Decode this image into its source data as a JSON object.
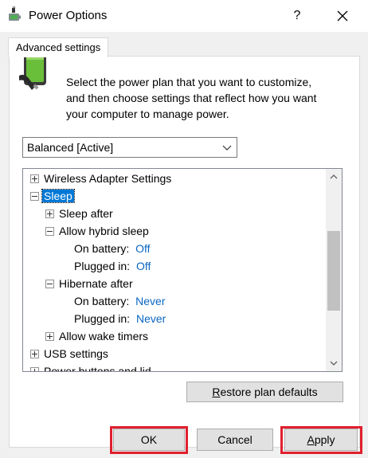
{
  "window": {
    "title": "Power Options",
    "help_label": "?",
    "close_label": "✕",
    "icon": "power-options-icon"
  },
  "tab": {
    "label": "Advanced settings"
  },
  "intro": {
    "line1": "Select the power plan that you want to customize,",
    "line2": "and then choose settings that reflect how you want",
    "line3": "your computer to manage power.",
    "icon": "battery-plug-icon"
  },
  "plan_select": {
    "value": "Balanced [Active]"
  },
  "tree": {
    "wireless": "Wireless Adapter Settings",
    "sleep": "Sleep",
    "sleep_after": "Sleep after",
    "hybrid_sleep": "Allow hybrid sleep",
    "hybrid_battery_label": "On battery:",
    "hybrid_battery_value": "Off",
    "hybrid_plugged_label": "Plugged in:",
    "hybrid_plugged_value": "Off",
    "hibernate_after": "Hibernate after",
    "hibernate_battery_label": "On battery:",
    "hibernate_battery_value": "Never",
    "hibernate_plugged_label": "Plugged in:",
    "hibernate_plugged_value": "Never",
    "wake_timers": "Allow wake timers",
    "usb": "USB settings",
    "power_buttons": "Power buttons and lid"
  },
  "buttons": {
    "restore_first": "R",
    "restore_rest": "estore plan defaults",
    "ok": "OK",
    "cancel": "Cancel",
    "apply_first": "A",
    "apply_rest": "pply"
  },
  "colors": {
    "accent": "#0078d7",
    "value_blue": "#0a66c2",
    "highlight_red": "#e0202e"
  }
}
